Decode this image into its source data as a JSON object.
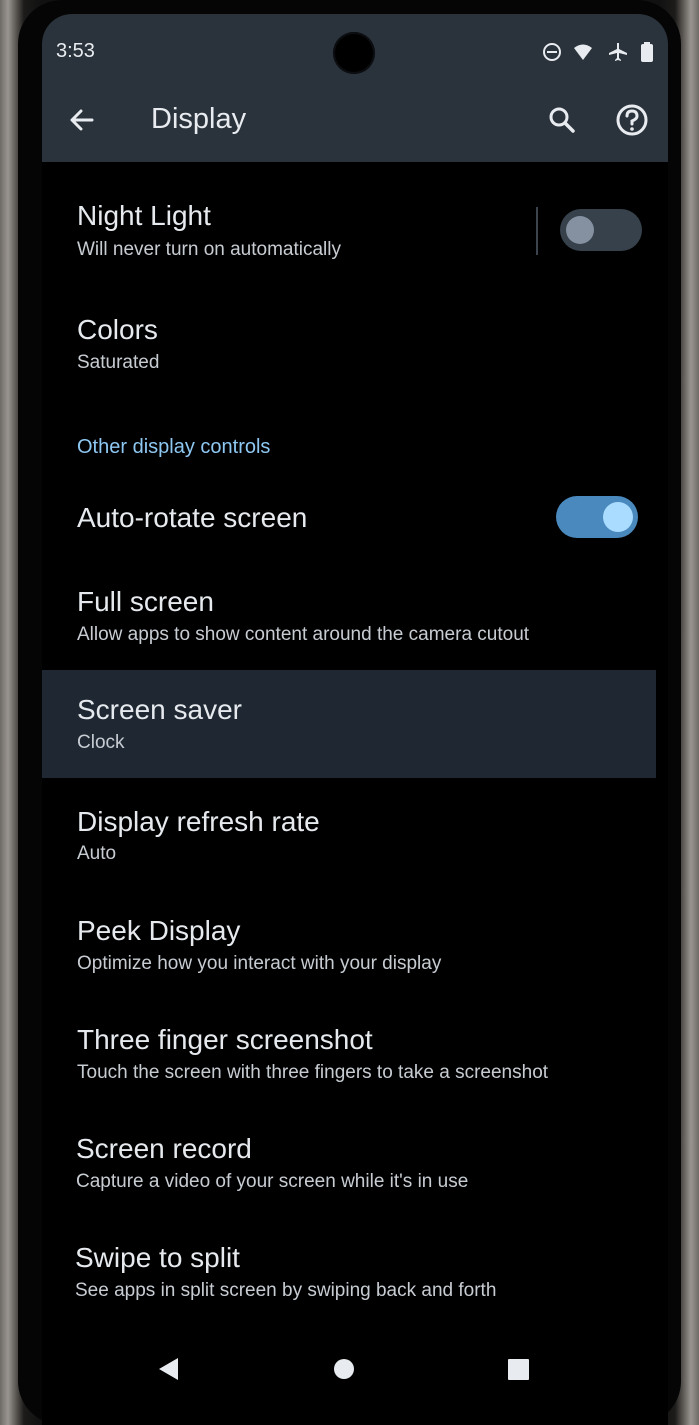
{
  "status_bar": {
    "time": "3:53",
    "icons": [
      "do-not-disturb-icon",
      "wifi-icon",
      "airplane-icon",
      "battery-icon"
    ]
  },
  "app_bar": {
    "title": "Display",
    "back_icon": "arrow-back-icon",
    "search_icon": "search-icon",
    "help_icon": "help-icon"
  },
  "settings": {
    "night_light": {
      "title": "Night Light",
      "summary": "Will never turn on automatically",
      "enabled": false
    },
    "colors": {
      "title": "Colors",
      "summary": "Saturated"
    },
    "section_header": "Other display controls",
    "auto_rotate": {
      "title": "Auto-rotate screen",
      "enabled": true
    },
    "full_screen": {
      "title": "Full screen",
      "summary": "Allow apps to show content around the camera cutout"
    },
    "screen_saver": {
      "title": "Screen saver",
      "summary": "Clock"
    },
    "refresh_rate": {
      "title": "Display refresh rate",
      "summary": "Auto"
    },
    "peek_display": {
      "title": "Peek Display",
      "summary": "Optimize how you interact with your display"
    },
    "three_finger": {
      "title": "Three finger screenshot",
      "summary": "Touch the screen with three fingers to take a screenshot"
    },
    "screen_record": {
      "title": "Screen record",
      "summary": "Capture a video of your screen while it's in use"
    },
    "swipe_split": {
      "title": "Swipe to split",
      "summary": "See apps in split screen by swiping back and forth"
    }
  },
  "nav_bar": {
    "icons": [
      "nav-back-icon",
      "nav-home-icon",
      "nav-recents-icon"
    ]
  },
  "colors": {
    "background": "#000000",
    "app_bar": "#2a323b",
    "accent": "#8ec8f2",
    "toggle_on": "#4a89bd"
  }
}
